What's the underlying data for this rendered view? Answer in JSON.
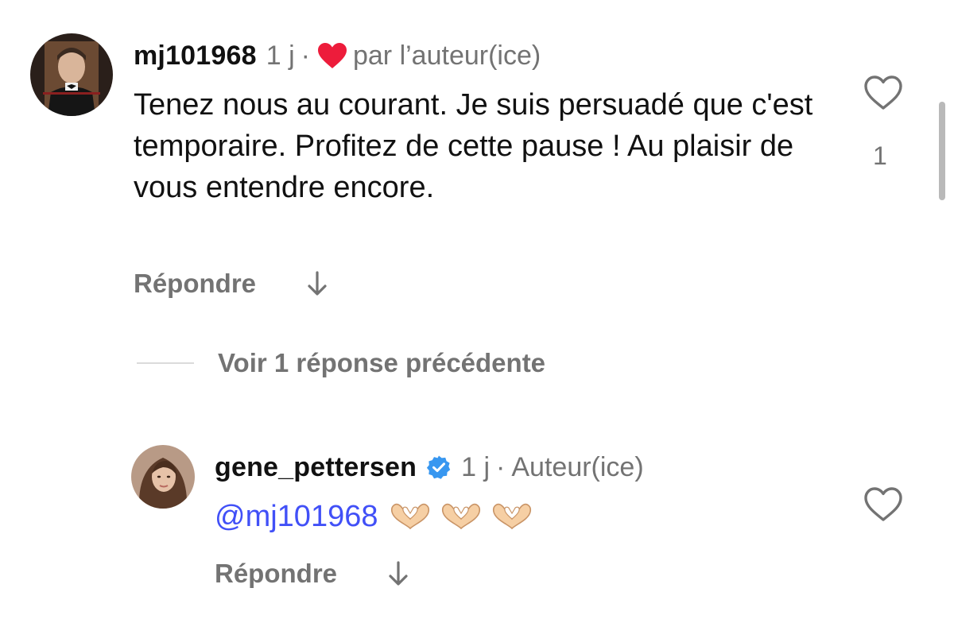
{
  "comment": {
    "username": "mj101968",
    "time": "1 j",
    "separator": "·",
    "liked_by_author_label": "par l’auteur(ice)",
    "text": "Tenez nous au courant. Je suis persuadé que c'est temporaire.  Profitez de cette pause ! Au plaisir de vous entendre encore.",
    "reply_label": "Répondre",
    "like_count": "1",
    "liked_heart_color": "#ed1c3b"
  },
  "view_previous_label": "Voir 1 réponse précédente",
  "reply": {
    "username": "gene_pettersen",
    "verified": true,
    "verified_color": "#3897f0",
    "time": "1 j",
    "separator": "·",
    "author_label": "Auteur(ice)",
    "mention": "@mj101968",
    "emoji": [
      "heart-hands-icon",
      "heart-hands-icon",
      "heart-hands-icon"
    ],
    "reply_label": "Répondre",
    "mention_color": "#4150f7"
  },
  "icons": {
    "like": "heart-outline-icon",
    "translate": "arrow-down-icon"
  }
}
